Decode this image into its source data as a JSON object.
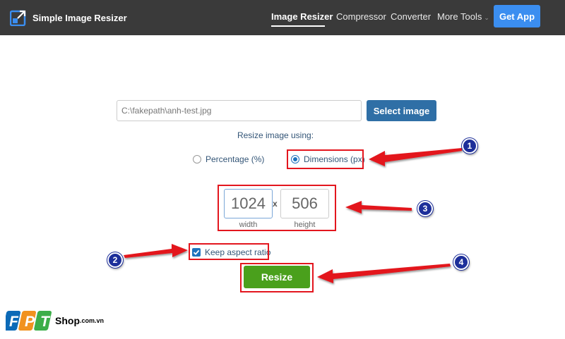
{
  "nav": {
    "brand": "Simple Image Resizer",
    "links": [
      "Image Resizer",
      "Compressor",
      "Converter",
      "More Tools"
    ],
    "get_app": "Get App"
  },
  "form": {
    "file_path": "C:\\fakepath\\anh-test.jpg",
    "select_button": "Select image",
    "resize_using_label": "Resize image using:",
    "option_percentage": "Percentage (%)",
    "option_dimensions": "Dimensions (px)",
    "selected_option": "dimensions",
    "width_value": "1024",
    "height_value": "506",
    "times_sign": "x",
    "width_label": "width",
    "height_label": "height",
    "keep_aspect_label": "Keep aspect ratio",
    "keep_aspect_checked": true,
    "resize_button": "Resize"
  },
  "annotations": {
    "badges": [
      "1",
      "2",
      "3",
      "4"
    ],
    "color": "#e3161e",
    "badge_color": "#1d2f9a"
  },
  "watermark": {
    "logo_text": "FPT",
    "shop": "Shop",
    "domain": ".com.vn"
  },
  "colors": {
    "navbar": "#3a3a3a",
    "get_app": "#3b8ef0",
    "select_button": "#2f6fa6",
    "resize_button": "#4aa01c",
    "label_text": "#335577"
  }
}
